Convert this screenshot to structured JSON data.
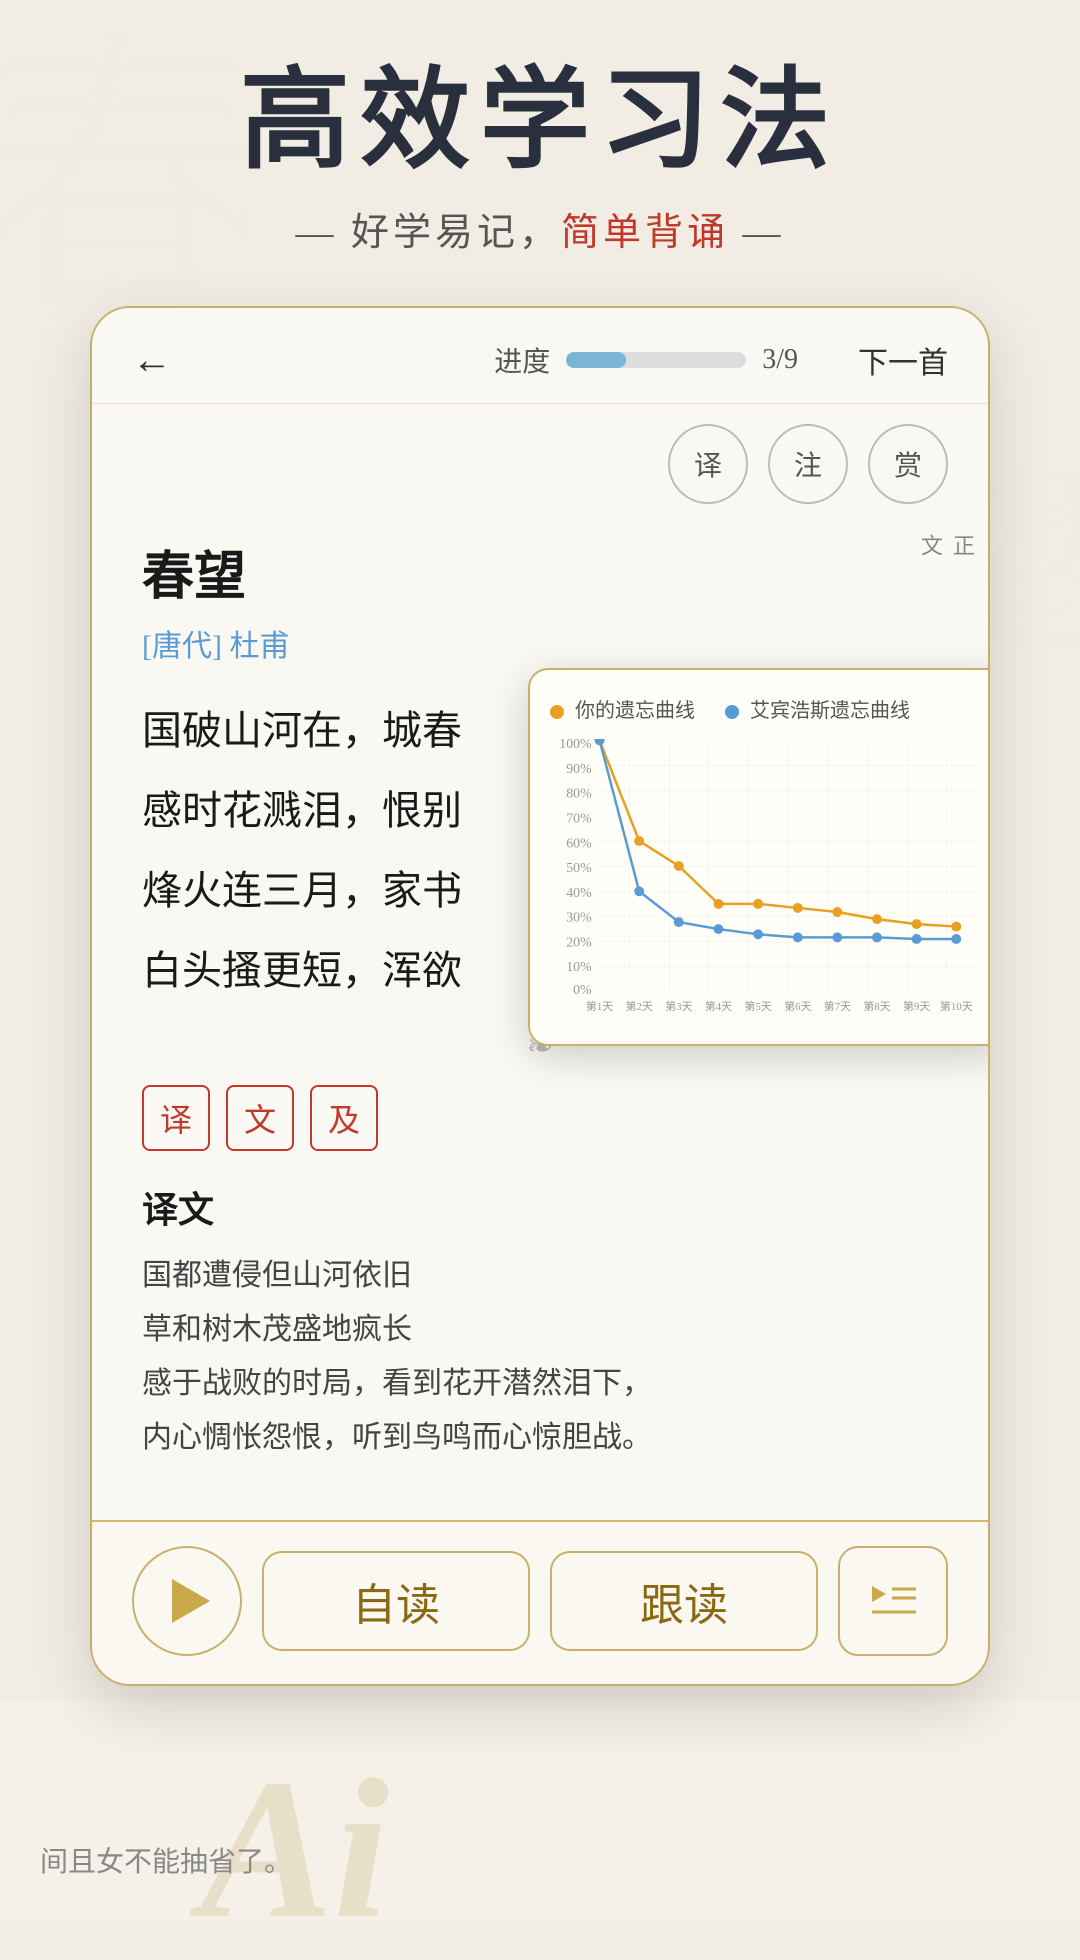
{
  "header": {
    "main_title": "高效学习法",
    "subtitle_prefix": "— 好学易记，",
    "subtitle_highlight": "简单背诵",
    "subtitle_suffix": " —"
  },
  "toolbar": {
    "back_label": "←",
    "progress_label": "进度",
    "progress_fraction": "3/9",
    "next_label": "下一首",
    "progress_percent": 33
  },
  "action_buttons": [
    {
      "label": "译",
      "name": "translate-btn"
    },
    {
      "label": "注",
      "name": "annotation-btn"
    },
    {
      "label": "赏",
      "name": "appreciate-btn"
    }
  ],
  "poem": {
    "title": "春望",
    "dynasty_bracket": "[唐代]",
    "author": "杜甫",
    "vertical_label": "正\n文",
    "lines": [
      "国破山河在，城春",
      "感时花溅泪，恨别",
      "烽火连三月，家书",
      "白头搔更短，浑欲"
    ],
    "tags": [
      "译",
      "文",
      "及"
    ]
  },
  "translation": {
    "title": "译文",
    "lines": [
      "国都遭侵但山河依旧",
      "草和树木茂盛地疯长",
      "感于战败的时局，看到花开潜然泪下，",
      "内心惆怅怨恨，听到鸟鸣而心惊胆战。"
    ]
  },
  "curve_chart": {
    "legend": [
      {
        "label": "你的遗忘曲线",
        "color": "#e8a020"
      },
      {
        "label": "艾宾浩斯遗忘曲线",
        "color": "#5b9bd5"
      }
    ],
    "y_labels": [
      "100%",
      "90%",
      "80%",
      "70%",
      "60%",
      "50%",
      "40%",
      "30%",
      "20%",
      "10%",
      "0%"
    ],
    "x_labels": [
      "第1天",
      "第2天",
      "第3天",
      "第4天",
      "第5天",
      "第6天",
      "第7天",
      "第8天",
      "第9天",
      "第10天"
    ],
    "user_data": [
      100,
      60,
      50,
      35,
      35,
      33,
      32,
      30,
      28,
      27
    ],
    "ebbinghaus_data": [
      100,
      40,
      28,
      25,
      23,
      22,
      22,
      22,
      21,
      21
    ]
  },
  "bottom_buttons": {
    "play_btn_label": "",
    "self_read_label": "自读",
    "follow_read_label": "跟读",
    "list_play_label": ""
  },
  "ai_section": {
    "ai_text": "Ai",
    "description": "间且女不能抽省了。"
  }
}
